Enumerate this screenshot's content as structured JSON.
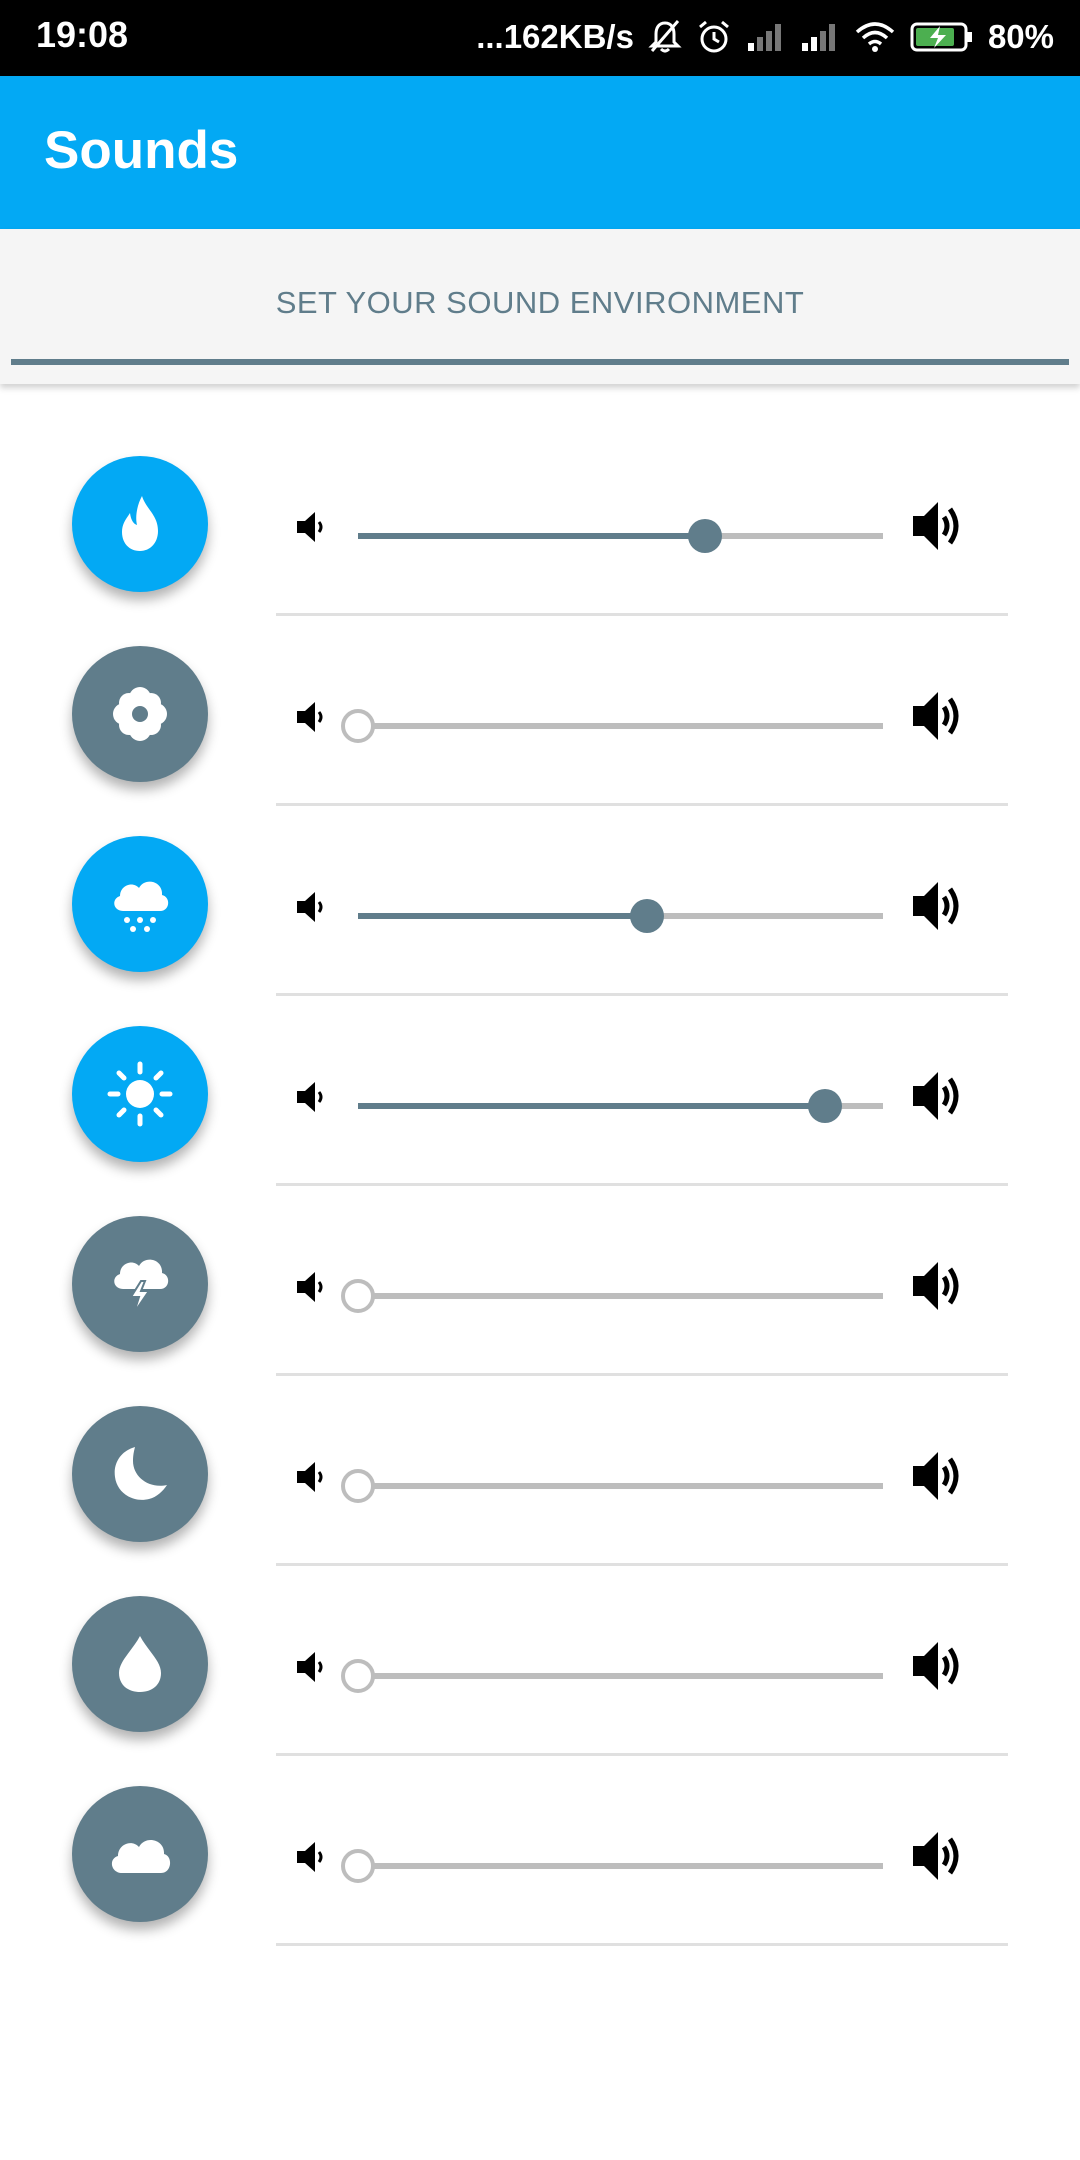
{
  "status_bar": {
    "time": "19:08",
    "speed": "...162KB/s",
    "battery": "80%"
  },
  "app_bar": {
    "title": "Sounds"
  },
  "tab": {
    "label": "SET YOUR SOUND ENVIRONMENT"
  },
  "colors": {
    "accent": "#03A9F4",
    "inactive": "#607D8B",
    "track": "#bdbdbd"
  },
  "sounds": [
    {
      "icon": "fire-icon",
      "active": true,
      "level": 0.66
    },
    {
      "icon": "flower-icon",
      "active": false,
      "level": 0.0
    },
    {
      "icon": "snow-cloud-icon",
      "active": true,
      "level": 0.55
    },
    {
      "icon": "sun-icon",
      "active": true,
      "level": 0.89
    },
    {
      "icon": "storm-cloud-icon",
      "active": false,
      "level": 0.0
    },
    {
      "icon": "moon-icon",
      "active": false,
      "level": 0.0
    },
    {
      "icon": "water-drop-icon",
      "active": false,
      "level": 0.0
    },
    {
      "icon": "cloud-icon",
      "active": false,
      "level": 0.0
    }
  ]
}
